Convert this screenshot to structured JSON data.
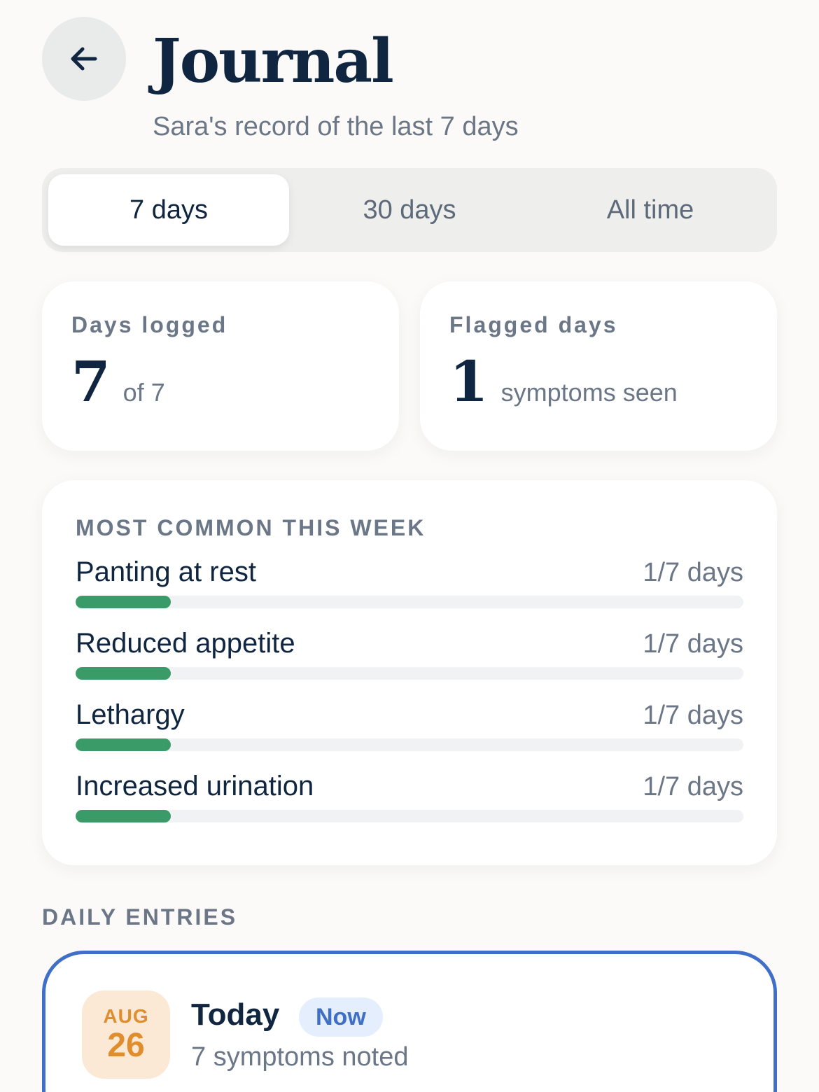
{
  "header": {
    "back_icon": "arrow-left-icon",
    "title": "Journal",
    "subtitle": "Sara's record of the last 7 days"
  },
  "range_tabs": [
    {
      "label": "7 days",
      "active": true
    },
    {
      "label": "30 days",
      "active": false
    },
    {
      "label": "All time",
      "active": false
    }
  ],
  "stats": {
    "days_logged": {
      "label": "Days logged",
      "value": "7",
      "unit": "of 7"
    },
    "flagged_days": {
      "label": "Flagged days",
      "value": "1",
      "unit": "symptoms seen"
    }
  },
  "most_common": {
    "heading": "MOST COMMON THIS WEEK",
    "items": [
      {
        "name": "Panting at rest",
        "count": "1/7 days",
        "fraction": 0.142857
      },
      {
        "name": "Reduced appetite",
        "count": "1/7 days",
        "fraction": 0.142857
      },
      {
        "name": "Lethargy",
        "count": "1/7 days",
        "fraction": 0.142857
      },
      {
        "name": "Increased urination",
        "count": "1/7 days",
        "fraction": 0.142857
      }
    ]
  },
  "daily_entries": {
    "heading": "DAILY ENTRIES",
    "entries": [
      {
        "month": "AUG",
        "day": "26",
        "title": "Today",
        "badge": "Now",
        "summary": "7 symptoms noted"
      }
    ]
  },
  "colors": {
    "accent_blue": "#3f6fc6",
    "progress_green": "#3a9a68",
    "date_orange": "#e08d2e",
    "navy_text": "#0f2540"
  }
}
